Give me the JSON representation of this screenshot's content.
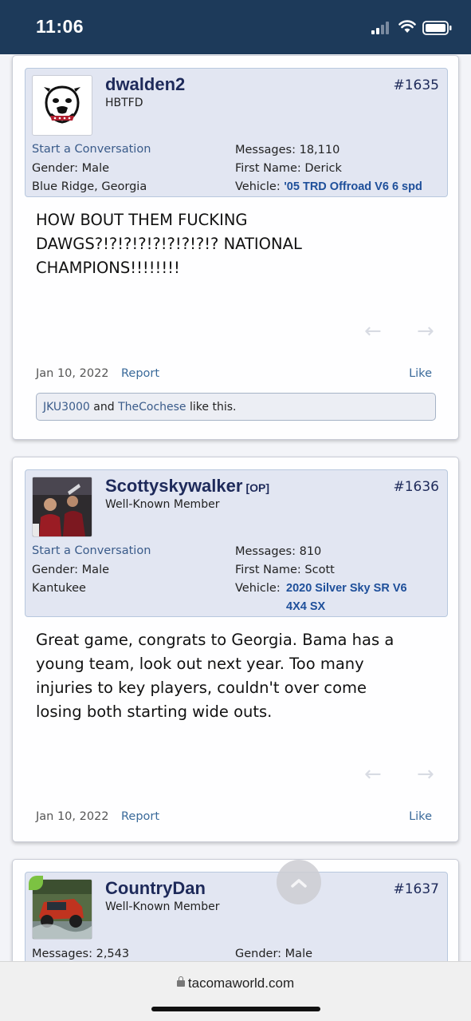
{
  "status_bar": {
    "time": "11:06"
  },
  "posts": [
    {
      "username": "dwalden2",
      "title": "HBTFD",
      "number": "#1635",
      "conversation": "Start a Conversation",
      "gender": "Gender: Male",
      "location": "Blue Ridge, Georgia",
      "messages": "Messages: 18,110",
      "first_name": "First Name: Derick",
      "vehicle_label": "Vehicle:",
      "vehicle_line1": "'05 TRD Offroad V6 6 spd",
      "message_lines": [
        "HOW BOUT THEM FUCKING",
        "DAWGS?!?!?!?!?!?!?!?!? NATIONAL",
        "CHAMPIONS!!!!!!!!"
      ],
      "date": "Jan 10, 2022",
      "report": "Report",
      "like": "Like",
      "likes": {
        "user1": "JKU3000",
        "and": "and",
        "user2": "TheCochese",
        "suffix": "like this."
      }
    },
    {
      "username": "Scottyskywalker",
      "op_tag": "[OP]",
      "title": "Well-Known Member",
      "number": "#1636",
      "conversation": "Start a Conversation",
      "gender": "Gender: Male",
      "location": "Kantukee",
      "messages": "Messages: 810",
      "first_name": "First Name: Scott",
      "vehicle_label": "Vehicle:",
      "vehicle_line1": "2020 Silver Sky SR V6",
      "vehicle_line2": "4X4 SX",
      "message_lines": [
        "Great game, congrats to Georgia. Bama has a",
        "young team, look out next year. Too many",
        "injuries to key players, couldn't over come",
        "losing both starting wide outs."
      ],
      "date": "Jan 10, 2022",
      "report": "Report",
      "like": "Like"
    },
    {
      "username": "CountryDan",
      "title": "Well-Known Member",
      "number": "#1637",
      "messages": "Messages: 2,543",
      "gender": "Gender: Male"
    }
  ],
  "browser": {
    "url": "tacomaworld.com"
  }
}
